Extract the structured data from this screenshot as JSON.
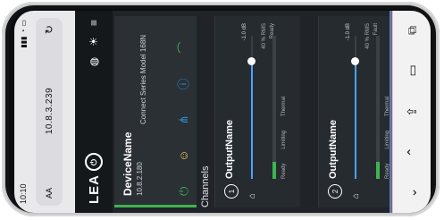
{
  "browser": {
    "time": "10:10",
    "carrier_icon": "signal-icon",
    "url": "10.8.3.239",
    "aa_label": "AA",
    "reload_icon": "reload-icon"
  },
  "app": {
    "logo_text": "LEA",
    "logo_mark": "⏻",
    "device": {
      "name": "DeviceName",
      "ip": "10.8.2.180",
      "model": "Connect Series Model 168N"
    },
    "channels_title": "Channels",
    "channels": [
      {
        "number": "1",
        "name": "OutputName",
        "readout": "-1.0 dB",
        "aux": [
          "40 % RMS",
          "Ready"
        ],
        "labels": [
          "Ready",
          "Limiting",
          "Thermal"
        ],
        "slider_level": 0.82,
        "meter_level": 0.12
      },
      {
        "number": "2",
        "name": "OutputName",
        "readout": "-1.0 dB",
        "aux": [
          "40 % RMS",
          "Fault"
        ],
        "labels": [
          "Ready",
          "Limiting",
          "Thermal"
        ],
        "slider_level": 0.82,
        "meter_level": 0.12
      }
    ]
  },
  "toolbar": {
    "buttons": [
      "chevron-down-icon",
      "chevron-up-icon",
      "share-icon",
      "book-icon",
      "tabs-icon"
    ]
  },
  "colors": {
    "accent_green": "#3fb34f",
    "accent_blue": "#2e8fd0",
    "accent_red": "#e23c4b",
    "app_bg": "#202428"
  }
}
